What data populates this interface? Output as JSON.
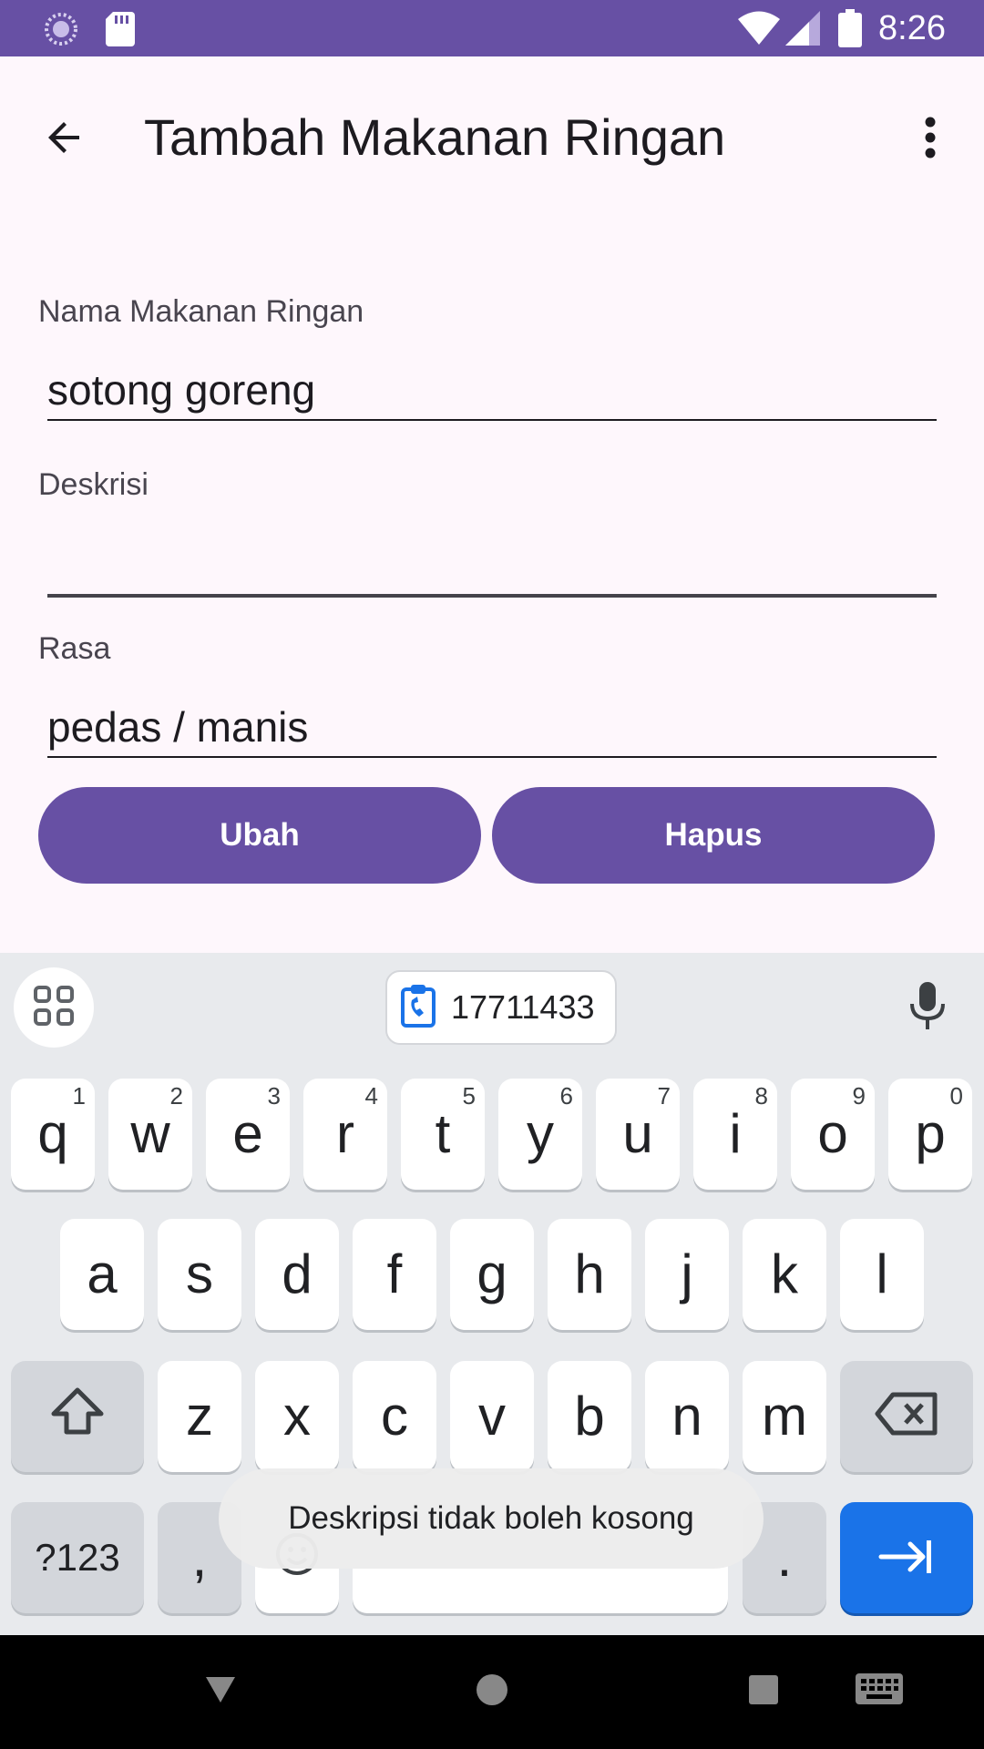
{
  "status_bar": {
    "time": "8:26",
    "icons": [
      "loading-icon",
      "sd-card-icon",
      "wifi-icon",
      "signal-icon",
      "battery-icon"
    ]
  },
  "app_bar": {
    "title": "Tambah Makanan Ringan",
    "back_icon": "arrow-back-icon",
    "more_icon": "more-vert-icon"
  },
  "form": {
    "name_label": "Nama Makanan Ringan",
    "name_value": "sotong goreng",
    "description_label": "Deskrisi",
    "description_value": "",
    "taste_label": "Rasa",
    "taste_value": "pedas / manis"
  },
  "buttons": {
    "edit_label": "Ubah",
    "delete_label": "Hapus"
  },
  "keyboard": {
    "clipboard_text": "17711433",
    "row1": [
      {
        "key": "q",
        "hint": "1"
      },
      {
        "key": "w",
        "hint": "2"
      },
      {
        "key": "e",
        "hint": "3"
      },
      {
        "key": "r",
        "hint": "4"
      },
      {
        "key": "t",
        "hint": "5"
      },
      {
        "key": "y",
        "hint": "6"
      },
      {
        "key": "u",
        "hint": "7"
      },
      {
        "key": "i",
        "hint": "8"
      },
      {
        "key": "o",
        "hint": "9"
      },
      {
        "key": "p",
        "hint": "0"
      }
    ],
    "row2": [
      "a",
      "s",
      "d",
      "f",
      "g",
      "h",
      "j",
      "k",
      "l"
    ],
    "row3": [
      "z",
      "x",
      "c",
      "v",
      "b",
      "n",
      "m"
    ],
    "symbols_label": "?123",
    "comma_label": ",",
    "period_label": "."
  },
  "toast": {
    "message": "Deskripsi tidak boleh kosong"
  },
  "colors": {
    "primary": "#6750a4",
    "background": "#fef7fc",
    "keyboard_bg": "#e8eaed",
    "action_key": "#1a73e8"
  }
}
